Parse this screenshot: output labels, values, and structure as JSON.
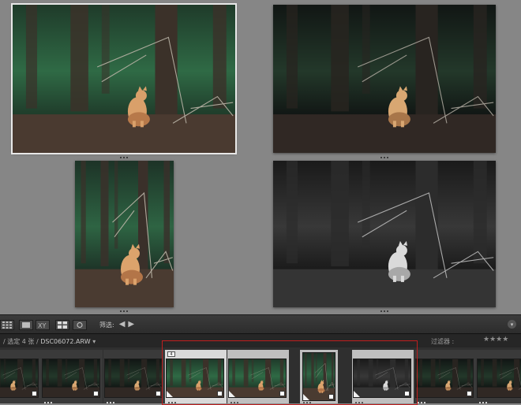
{
  "toolbar": {
    "filter_label": "筛选:",
    "prev_icon": "arrow-left-icon",
    "next_icon": "arrow-right-icon",
    "menu_icon": "chevron-down-icon",
    "view_buttons": [
      "grid-view-icon",
      "loupe-view-icon",
      "compare-view-icon",
      "survey-view-icon",
      "people-view-icon"
    ]
  },
  "strip_header": {
    "path_prefix": "/ 选定 4 张 /",
    "filename": "DSC06072.ARW",
    "path_suffix": "▾",
    "filter_label": "过滤器 :",
    "stars": "★★★★"
  },
  "survey": {
    "photos": [
      {
        "name": "survey-photo-color-selected",
        "variant": "color",
        "selected": true
      },
      {
        "name": "survey-photo-dark",
        "variant": "dark",
        "selected": false
      },
      {
        "name": "survey-photo-portrait",
        "variant": "portrait",
        "selected": false
      },
      {
        "name": "survey-photo-bw",
        "variant": "bw",
        "selected": false
      }
    ]
  },
  "filmstrip": {
    "selected_number": "4",
    "highlight_color": "#c01e1e",
    "cells": [
      {
        "variant": "dark"
      },
      {
        "variant": "dark"
      },
      {
        "variant": "dark"
      },
      {
        "variant": "color",
        "bg": "lighter"
      },
      {
        "variant": "color",
        "bg": "light"
      },
      {
        "variant": "portrait",
        "bg": "light"
      },
      {
        "variant": "bw",
        "bg": "light"
      },
      {
        "variant": "dark"
      },
      {
        "variant": "dark"
      }
    ]
  }
}
